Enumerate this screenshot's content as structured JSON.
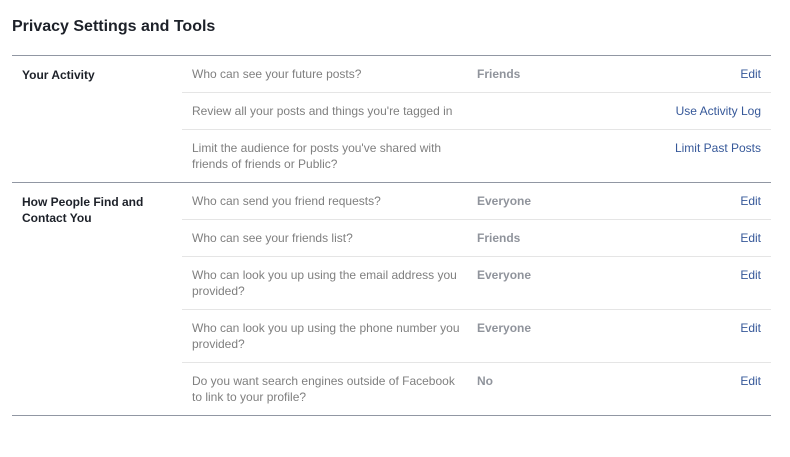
{
  "page": {
    "title": "Privacy Settings and Tools"
  },
  "sections": [
    {
      "label": "Your Activity",
      "rows": [
        {
          "question": "Who can see your future posts?",
          "value": "Friends",
          "action": "Edit"
        },
        {
          "question": "Review all your posts and things you're tagged in",
          "value": "",
          "action": "Use Activity Log"
        },
        {
          "question": "Limit the audience for posts you've shared with friends of friends or Public?",
          "value": "",
          "action": "Limit Past Posts"
        }
      ]
    },
    {
      "label": "How People Find and Contact You",
      "rows": [
        {
          "question": "Who can send you friend requests?",
          "value": "Everyone",
          "action": "Edit"
        },
        {
          "question": "Who can see your friends list?",
          "value": "Friends",
          "action": "Edit"
        },
        {
          "question": "Who can look you up using the email address you provided?",
          "value": "Everyone",
          "action": "Edit"
        },
        {
          "question": "Who can look you up using the phone number you provided?",
          "value": "Everyone",
          "action": "Edit"
        },
        {
          "question": "Do you want search engines outside of Facebook to link to your profile?",
          "value": "No",
          "action": "Edit"
        }
      ]
    }
  ]
}
